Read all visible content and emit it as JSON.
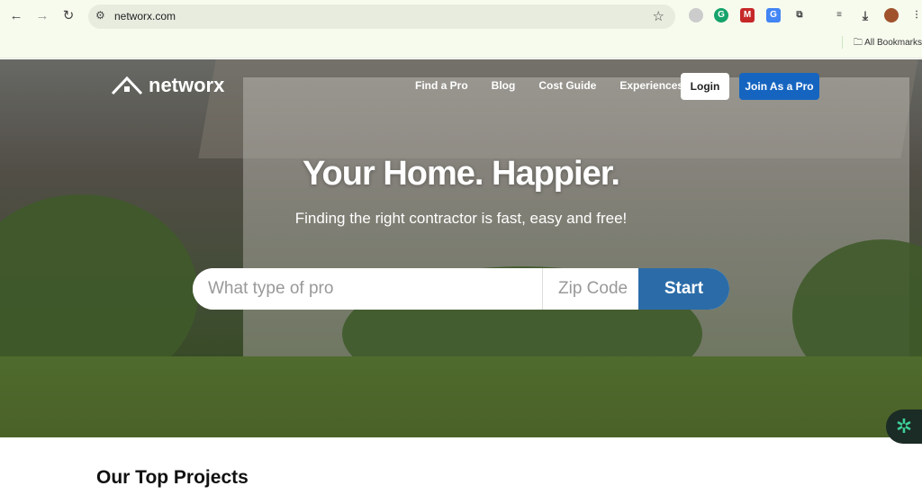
{
  "browser": {
    "url": "networx.com",
    "bookmarks_label": "All Bookmarks"
  },
  "site": {
    "logo": "networx",
    "nav": [
      {
        "label": "Find a Pro"
      },
      {
        "label": "Blog"
      },
      {
        "label": "Cost Guide"
      },
      {
        "label": "Experiences"
      }
    ],
    "login": "Login",
    "join": "Join As a Pro"
  },
  "hero": {
    "title": "Your Home. Happier.",
    "subtitle": "Finding the right contractor is fast, easy and free!",
    "pro_placeholder": "What type of pro",
    "zip_placeholder": "Zip Code",
    "start": "Start"
  },
  "section": {
    "title": "Our Top Projects"
  },
  "colors": {
    "accent": "#1565c0",
    "start": "#2b6ca8"
  }
}
